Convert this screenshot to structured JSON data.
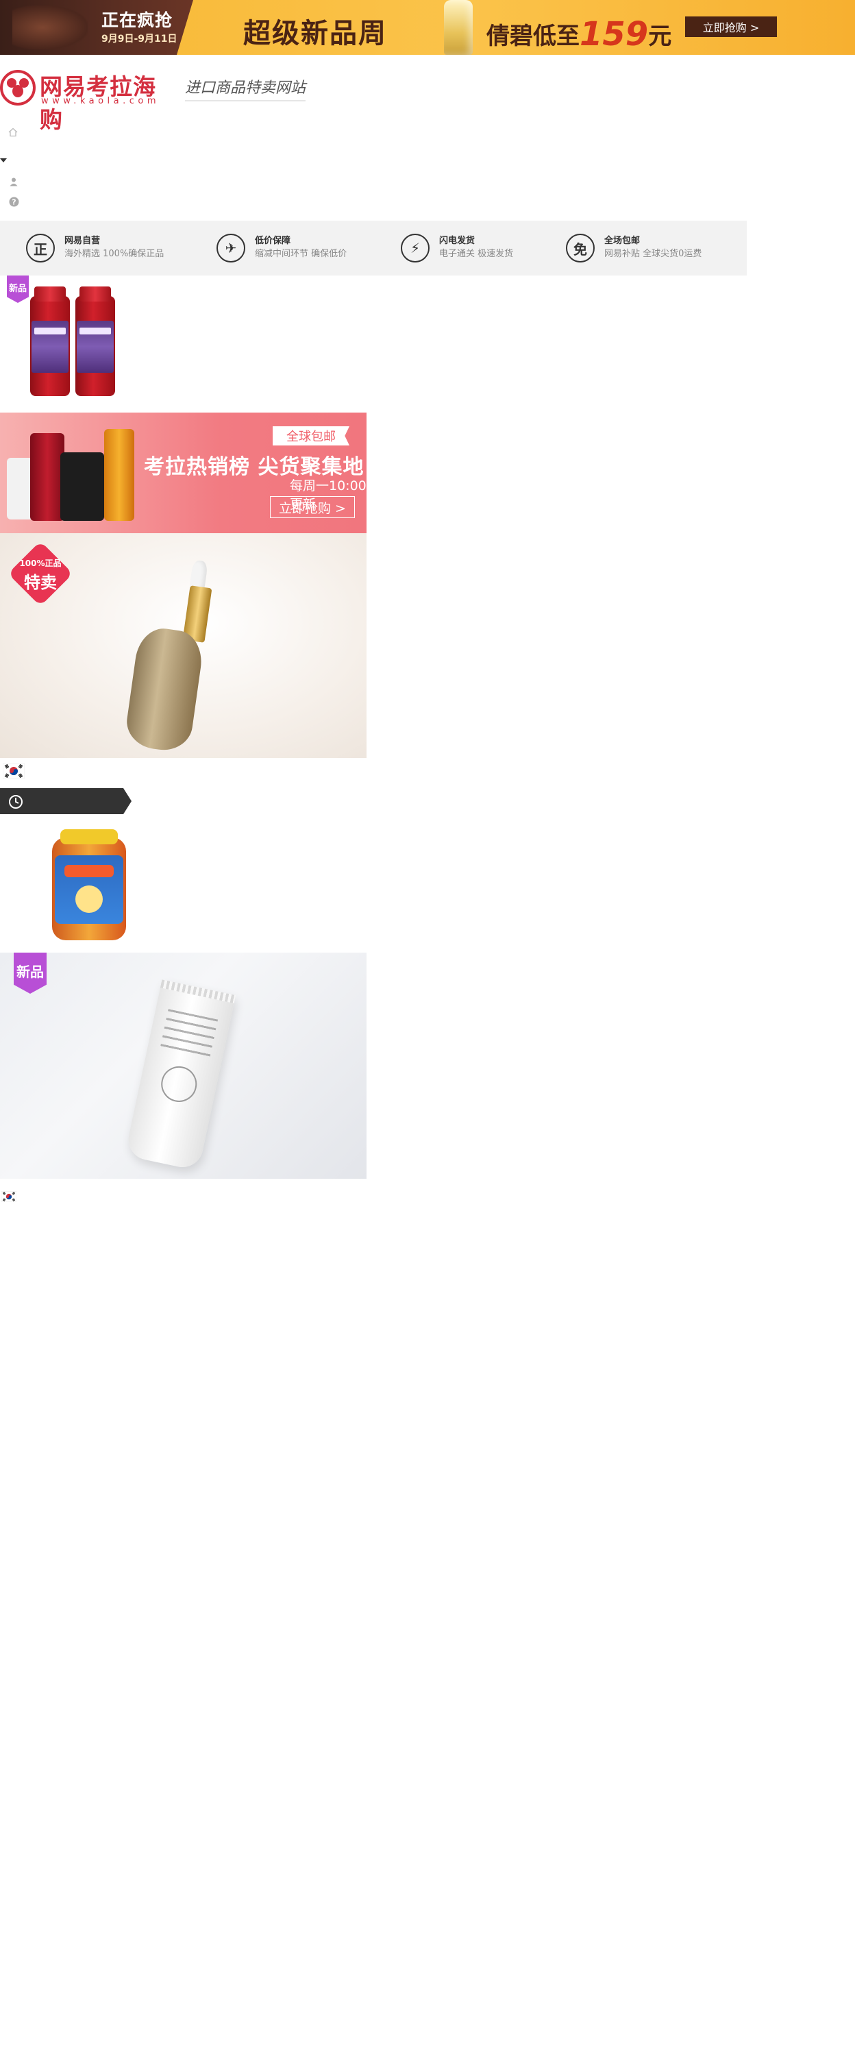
{
  "top_banner": {
    "left_title": "正在疯抢",
    "left_date": "9月9日-9月11日",
    "headline": "超级新品周",
    "price_prefix": "倩碧低至",
    "price_value": "159",
    "price_suffix": "元",
    "cta": "立即抢购 >",
    "colors": {
      "dark": "#3a1f18",
      "gold": "#f7b733",
      "price": "#d6361c"
    }
  },
  "logo": {
    "name": "网易考拉海购",
    "url": "www.kaola.com",
    "slogan": "进口商品特卖网站",
    "brand_color": "#d42f3f"
  },
  "nav_icons": [
    "home-icon",
    "caret-down-icon",
    "user-icon",
    "help-icon"
  ],
  "promises": [
    {
      "icon_glyph": "正",
      "title": "网易自营",
      "sub": "海外精选 100%确保正品"
    },
    {
      "icon_glyph": "✈",
      "title": "低价保障",
      "sub": "缩减中间环节 确保低价"
    },
    {
      "icon_glyph": "⚡",
      "title": "闪电发货",
      "sub": "电子通关 极速发货"
    },
    {
      "icon_glyph": "免",
      "title": "全场包邮",
      "sub": "网易补贴 全球尖货0运费"
    }
  ],
  "product_grapeseed": {
    "badge": "新品"
  },
  "sale_banner": {
    "ribbon": "全球包邮",
    "title": "考拉热销榜 尖货聚集地",
    "sub": "每周一10:00更新",
    "cta": "立即抢购 >"
  },
  "serum_banner": {
    "badge_top": "100%正品",
    "badge_main": "特卖"
  },
  "lotion_banner": {
    "badge": "新品"
  }
}
